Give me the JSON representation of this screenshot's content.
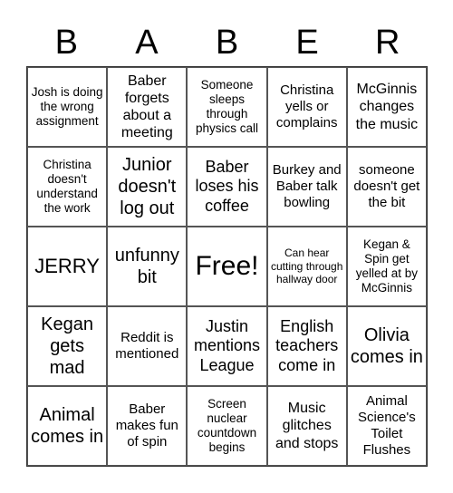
{
  "header": {
    "letters": [
      "B",
      "A",
      "B",
      "E",
      "R"
    ]
  },
  "cells": [
    "Josh is doing the wrong assignment",
    "Baber forgets about a meeting",
    "Someone sleeps through physics call",
    "Christina yells or complains",
    "McGinnis changes the music",
    "Christina doesn't understand the work",
    "Junior doesn't log out",
    "Baber loses his coffee",
    "Burkey and Baber talk bowling",
    "someone doesn't get the bit",
    "JERRY",
    "unfunny bit",
    "Free!",
    "Can hear cutting through hallway door",
    "Kegan & Spin get yelled at by McGinnis",
    "Kegan gets mad",
    "Reddit is mentioned",
    "Justin mentions League",
    "English teachers come in",
    "Olivia comes in",
    "Animal comes in",
    "Baber makes fun of spin",
    "Screen nuclear countdown begins",
    "Music glitches and stops",
    "Animal Science's Toilet Flushes"
  ]
}
